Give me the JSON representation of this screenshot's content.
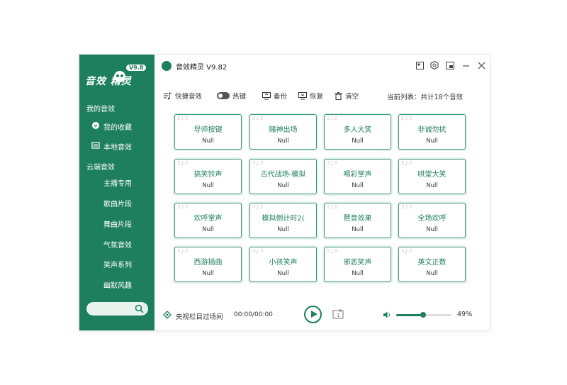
{
  "app": {
    "title": "音效精灵 V9.82",
    "logo_text": "音效 精灵",
    "logo_version": "V9.8"
  },
  "sidebar": {
    "section_mine": "我的音效",
    "favorites": "我的收藏",
    "local": "本地音效",
    "section_cloud": "云端音效",
    "cloud_items": [
      "主播专用",
      "歌曲片段",
      "舞曲片段",
      "气氛音效",
      "笑声系列",
      "幽默风趣"
    ],
    "search_placeholder": ""
  },
  "toolbar": {
    "quick": "快捷音效",
    "hotkey": "热键",
    "backup": "备份",
    "restore": "恢复",
    "clear": "清空",
    "count": "当前列表：共计18个音效"
  },
  "cards": [
    {
      "name": "导师按键",
      "key": "Null"
    },
    {
      "name": "赌神出场",
      "key": "Null"
    },
    {
      "name": "多人大笑",
      "key": "Null"
    },
    {
      "name": "非诚勿扰",
      "key": "Null"
    },
    {
      "name": "搞笑铃声",
      "key": "Null"
    },
    {
      "name": "古代战场-模拟",
      "key": "Null"
    },
    {
      "name": "喝彩掌声",
      "key": "Null"
    },
    {
      "name": "哄堂大笑",
      "key": "Null"
    },
    {
      "name": "欢呼掌声",
      "key": "Null"
    },
    {
      "name": "模拟倒计时2(",
      "key": "Null"
    },
    {
      "name": "琶音效果",
      "key": "Null"
    },
    {
      "name": "全场欢呼",
      "key": "Null"
    },
    {
      "name": "西游插曲",
      "key": "Null"
    },
    {
      "name": "小孩笑声",
      "key": "Null"
    },
    {
      "name": "邪恶笑声",
      "key": "Null"
    },
    {
      "name": "英文正数",
      "key": "Null"
    }
  ],
  "card_watermark": "S.J.S",
  "player": {
    "now_playing": "央视栏目过场间",
    "time": "00:00/00:00",
    "volume_percent": 49,
    "volume_label": "49%"
  },
  "colors": {
    "brand": "#1e7f5f"
  }
}
